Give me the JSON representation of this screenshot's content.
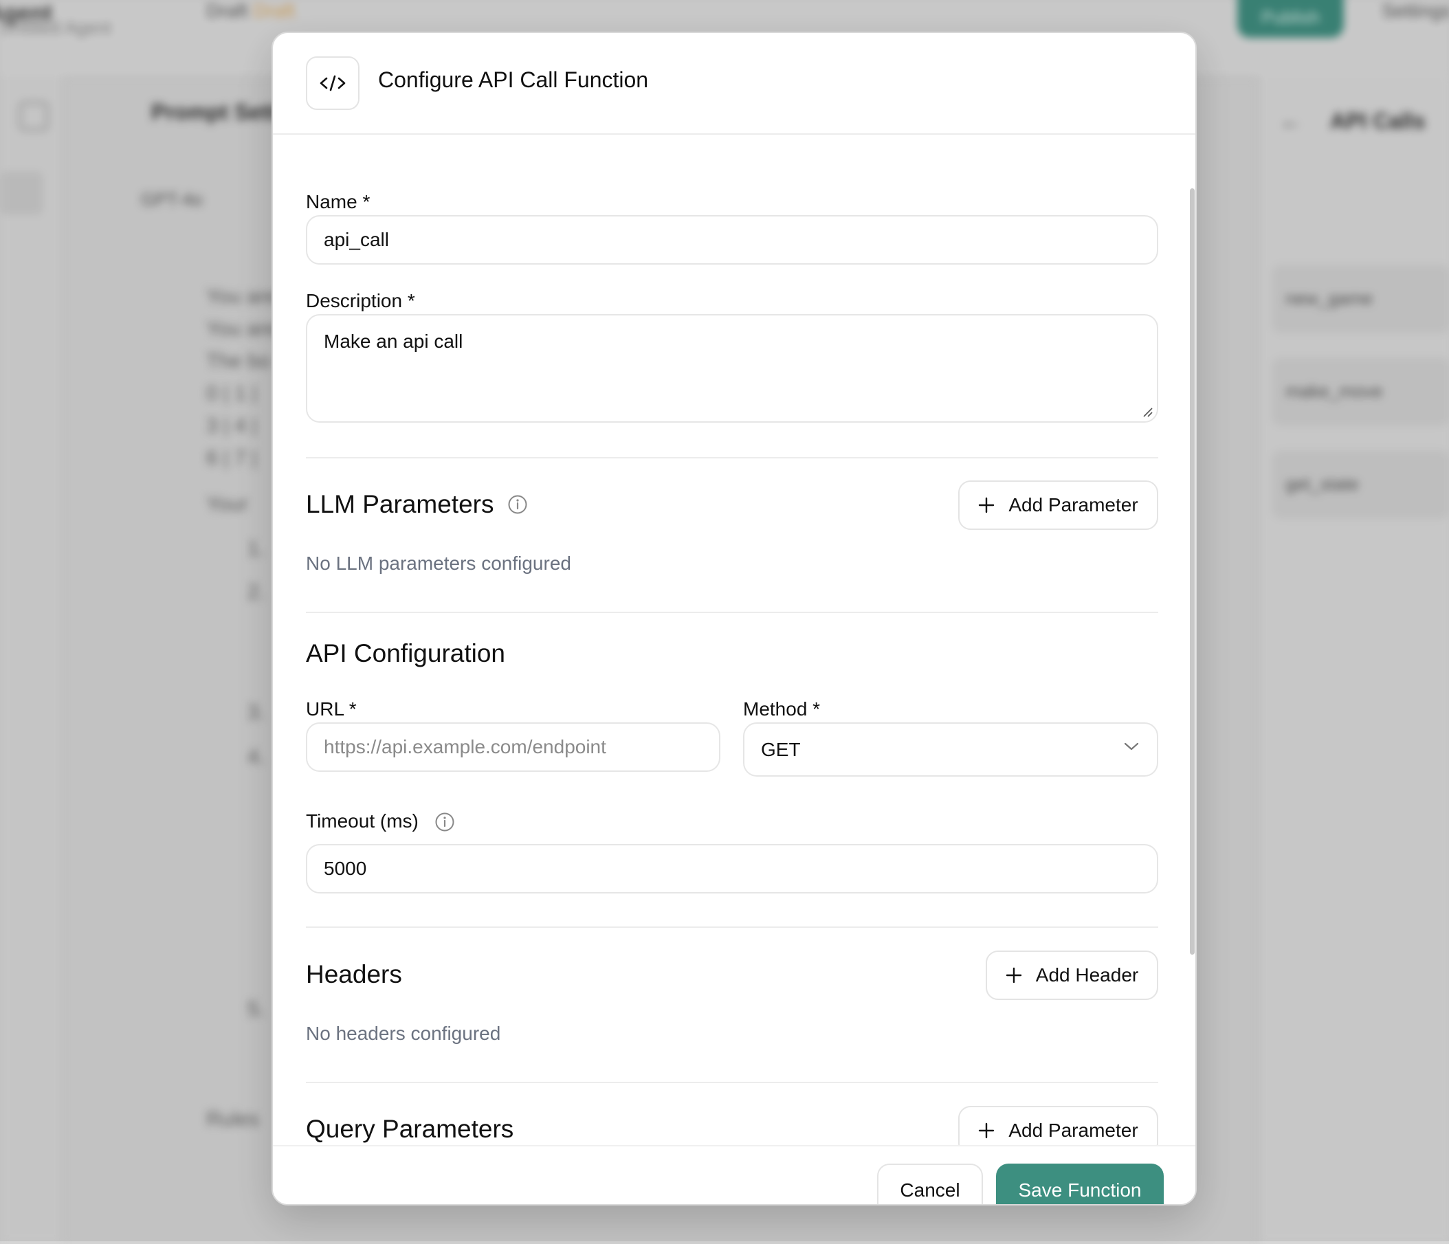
{
  "background": {
    "app_title": "Agent",
    "app_subtitle": "Untitled Agent",
    "draft_label": "Draft",
    "draft_tag": "Draft",
    "publish_label": "Publish",
    "settings_label": "Settings",
    "prompt_title": "Prompt Settings",
    "model_label": "GPT-4o",
    "right_panel_title": "API Calls",
    "right_cards": [
      "new_game",
      "make_move",
      "get_state"
    ],
    "prompt_lines": [
      "You are",
      "You are",
      "The bo",
      "0 | 1 |",
      "3 | 4 |",
      "6 | 7 |",
      "Your",
      "1.",
      "2.",
      "3.",
      "4.",
      "5.",
      "Rules"
    ]
  },
  "modal": {
    "icon": "code-icon",
    "title": "Configure API Call Function",
    "name_label": "Name *",
    "name_value": "api_call",
    "description_label": "Description *",
    "description_value": "Make an api call",
    "llm_params": {
      "title": "LLM Parameters",
      "add_label": "Add Parameter",
      "empty_text": "No LLM parameters configured"
    },
    "api_config": {
      "title": "API Configuration",
      "url_label": "URL *",
      "url_placeholder": "https://api.example.com/endpoint",
      "method_label": "Method *",
      "method_value": "GET",
      "timeout_label": "Timeout (ms)",
      "timeout_value": "5000"
    },
    "headers": {
      "title": "Headers",
      "add_label": "Add Header",
      "empty_text": "No headers configured"
    },
    "query_params": {
      "title": "Query Parameters",
      "add_label": "Add Parameter"
    },
    "footer": {
      "cancel_label": "Cancel",
      "save_label": "Save Function"
    }
  },
  "colors": {
    "accent": "#3d8f80",
    "muted_text": "#6b7280",
    "border": "#e6e6e6"
  }
}
